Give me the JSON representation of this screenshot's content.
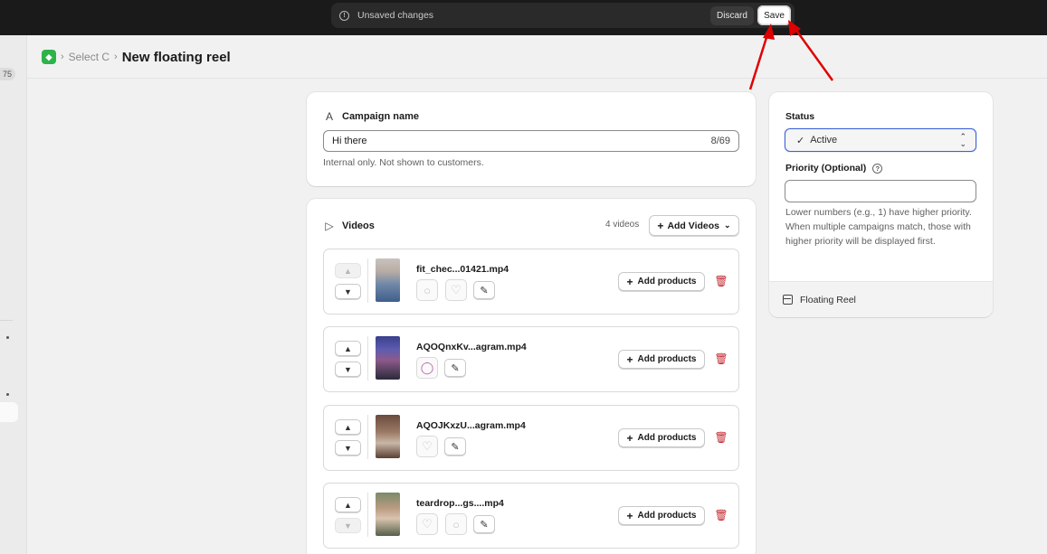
{
  "topbar": {
    "unsaved_text": "Unsaved changes",
    "discard_label": "Discard",
    "save_label": "Save"
  },
  "nav": {
    "badge": "75"
  },
  "header": {
    "breadcrumb_parent": "Select C",
    "page_title": "New floating reel"
  },
  "campaign": {
    "title": "Campaign name",
    "name_value": "Hi there",
    "char_count": "8/69",
    "help_text": "Internal only. Not shown to customers."
  },
  "videos": {
    "title": "Videos",
    "count_text": "4 videos",
    "add_videos_label": "Add Videos",
    "add_products_label": "Add products",
    "items": [
      {
        "filename": "fit_chec...01421.mp4"
      },
      {
        "filename": "AQOQnxKv...agram.mp4"
      },
      {
        "filename": "AQOJKxzU...agram.mp4"
      },
      {
        "filename": "teardrop...gs....mp4"
      }
    ]
  },
  "status_panel": {
    "status_label": "Status",
    "status_value": "Active",
    "priority_label": "Priority (Optional)",
    "priority_value": "",
    "priority_help": "Lower numbers (e.g., 1) have higher priority. When multiple campaigns match, those with higher priority will be displayed first.",
    "footer_label": "Floating Reel"
  },
  "colors": {
    "accent_blue": "#3b62d6",
    "danger_red": "#c0262d",
    "annotation_arrow": "#e00000",
    "app_green": "#2cb34a"
  }
}
